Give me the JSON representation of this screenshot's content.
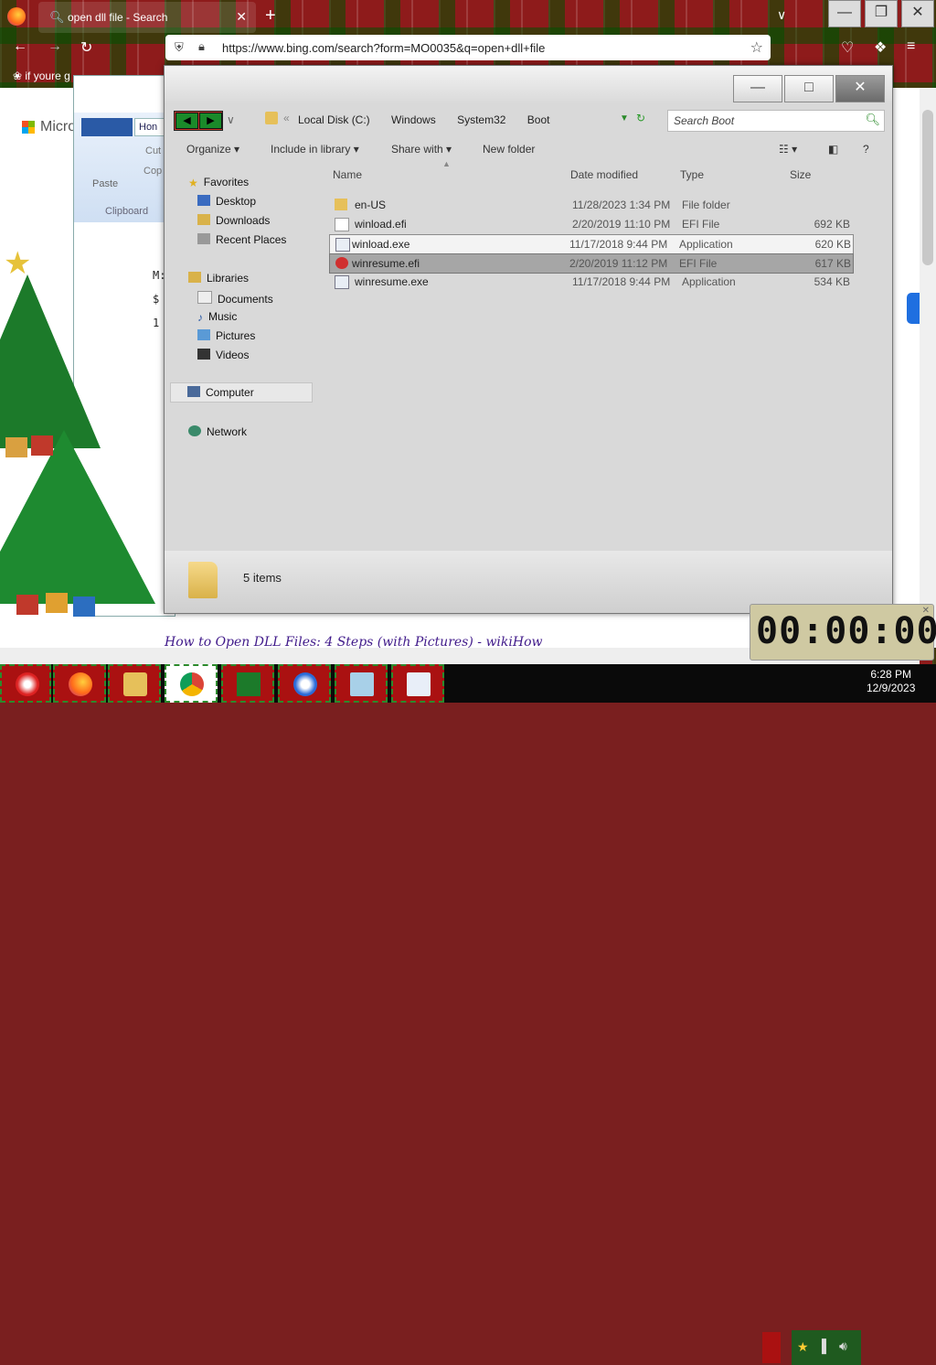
{
  "browser": {
    "tab_title": "open dll file - Search",
    "url": "https://www.bing.com/search?form=MO0035&q=open+dll+file",
    "bookmark_label": "if youre g",
    "new_tab_symbol": "+",
    "tab_close_symbol": "✕"
  },
  "web": {
    "brand_partial": "Micro",
    "result_title": "How to Open DLL Files: 4 Steps (with Pictures) - wikiHow"
  },
  "word": {
    "home_tab": "Hon",
    "paste": "Paste",
    "clipboard": "Clipboard",
    "cut": "Cut",
    "copy": "Cop",
    "doc_lines": [
      "M:",
      "$",
      "",
      "1"
    ]
  },
  "explorer": {
    "breadcrumb": [
      "Local Disk (C:)",
      "Windows",
      "System32",
      "Boot"
    ],
    "search_placeholder": "Search Boot",
    "toolbar": {
      "organize": "Organize",
      "include": "Include in library",
      "share": "Share with",
      "new_folder": "New folder"
    },
    "columns": {
      "name": "Name",
      "date": "Date modified",
      "type": "Type",
      "size": "Size"
    },
    "nav": {
      "favorites": "Favorites",
      "desktop": "Desktop",
      "downloads": "Downloads",
      "recent": "Recent Places",
      "libraries": "Libraries",
      "documents": "Documents",
      "music": "Music",
      "pictures": "Pictures",
      "videos": "Videos",
      "computer": "Computer",
      "network": "Network"
    },
    "files": [
      {
        "name": "en-US",
        "date": "11/28/2023 1:34 PM",
        "type": "File folder",
        "size": ""
      },
      {
        "name": "winload.efi",
        "date": "2/20/2019 11:10 PM",
        "type": "EFI File",
        "size": "692 KB"
      },
      {
        "name": "winload.exe",
        "date": "11/17/2018 9:44 PM",
        "type": "Application",
        "size": "620 KB"
      },
      {
        "name": "winresume.efi",
        "date": "2/20/2019 11:12 PM",
        "type": "EFI File",
        "size": "617 KB"
      },
      {
        "name": "winresume.exe",
        "date": "11/17/2018 9:44 PM",
        "type": "Application",
        "size": "534 KB"
      }
    ],
    "status_items": "5 items"
  },
  "taskbar": {
    "time": "6:28 PM",
    "date": "12/9/2023"
  },
  "timer": {
    "display": "00:00:00"
  },
  "colors": {
    "taskbar_button": "#aa1111",
    "accent_green": "#2c8a2c",
    "selected_row": "#a6a6a6"
  }
}
